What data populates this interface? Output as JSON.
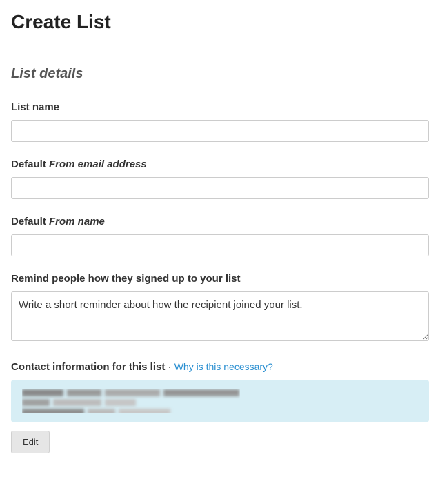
{
  "page": {
    "title": "Create List"
  },
  "section": {
    "title": "List details"
  },
  "fields": {
    "list_name": {
      "label": "List name",
      "value": ""
    },
    "from_email": {
      "label_prefix": "Default ",
      "label_italic": "From email address",
      "value": ""
    },
    "from_name": {
      "label_prefix": "Default ",
      "label_italic": "From name",
      "value": ""
    },
    "reminder": {
      "label": "Remind people how they signed up to your list",
      "value": "Write a short reminder about how the recipient joined your list."
    }
  },
  "contact": {
    "label": "Contact information for this list",
    "separator": " · ",
    "help_link": "Why is this necessary?",
    "edit_label": "Edit"
  }
}
